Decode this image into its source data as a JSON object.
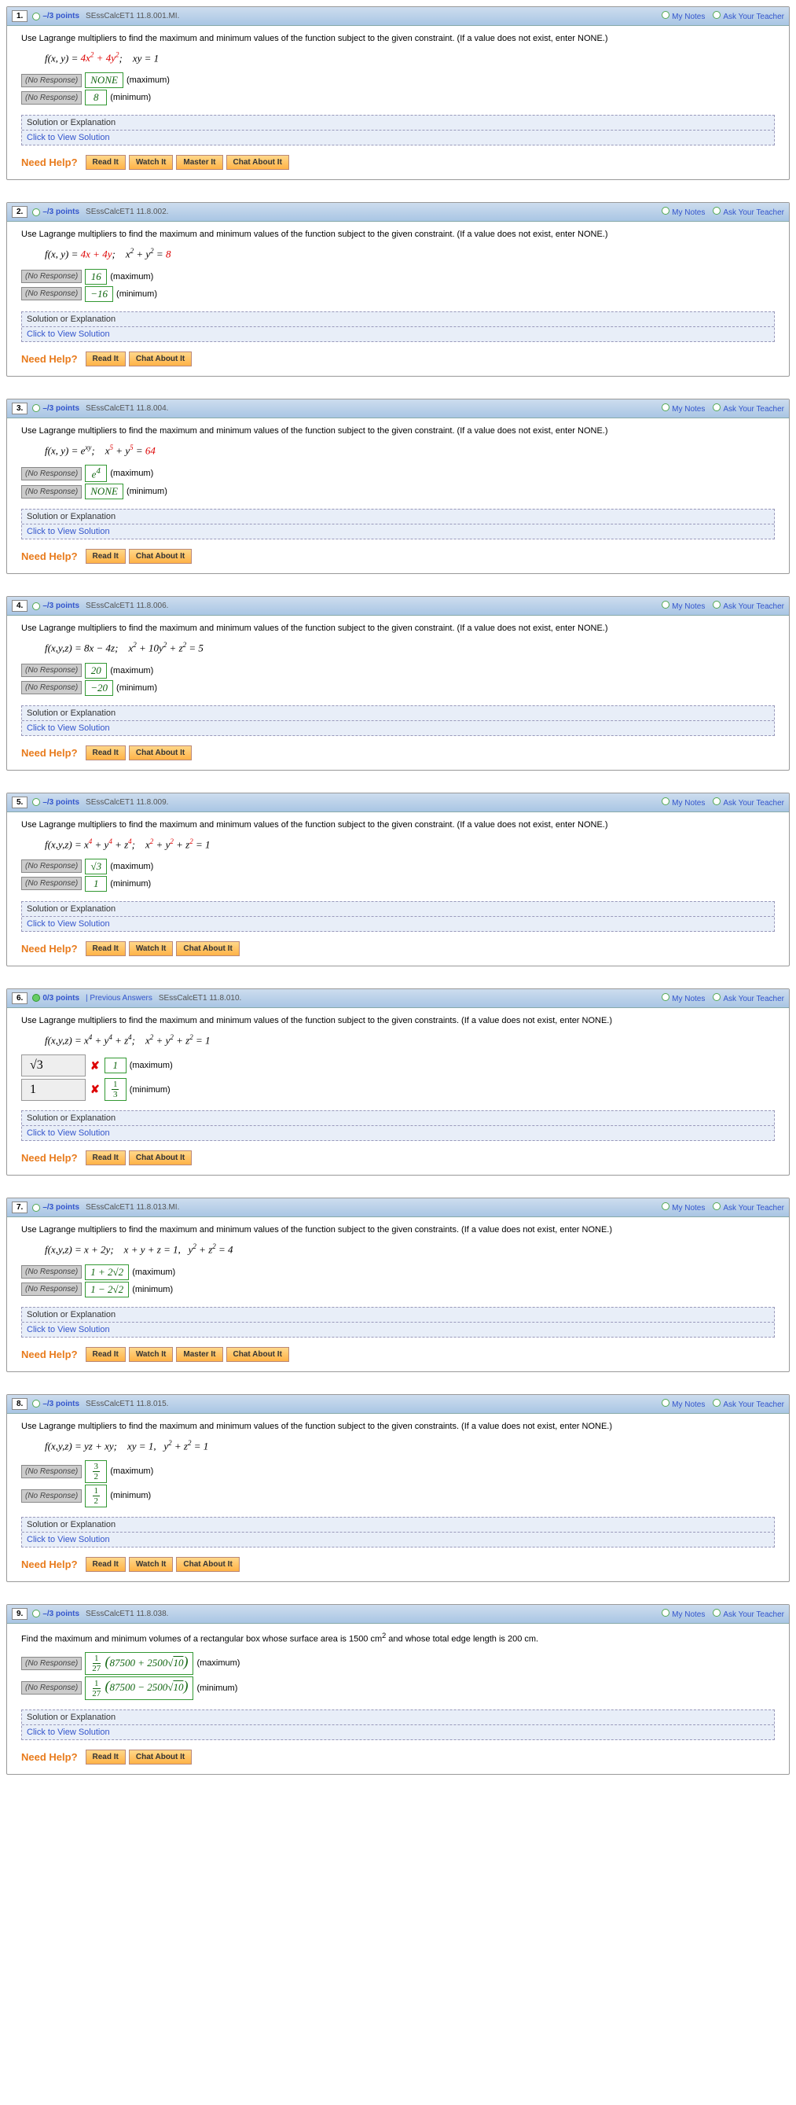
{
  "hdr": {
    "mynotes": "My Notes",
    "ask": "Ask Your Teacher",
    "nores": "(No Response)",
    "max": "(maximum)",
    "min": "(minimum)",
    "sol": "Solution or Explanation",
    "view": "Click to View Solution",
    "help": "Need Help?",
    "prev": "Previous Answers"
  },
  "btn": {
    "read": "Read It",
    "watch": "Watch It",
    "master": "Master It",
    "chat": "Chat About It"
  },
  "q": [
    {
      "num": "1.",
      "pts": "–/3 points",
      "code": "SEssCalcET1 11.8.001.MI.",
      "prompt": "Use Lagrange multipliers to find the maximum and minimum values of the function subject to the given constraint. (If a value does not exist, enter NONE.)",
      "eq_html": "<i>f</i>(<i>x</i>, <i>y</i>) = <span class='red'>4<i>x</i><sup>2</sup> + 4<i>y</i><sup>2</sup></span>; &nbsp;&nbsp; <i>xy</i> = 1",
      "amax": "NONE",
      "amin": "8",
      "buttons": [
        "read",
        "watch",
        "master",
        "chat"
      ]
    },
    {
      "num": "2.",
      "pts": "–/3 points",
      "code": "SEssCalcET1 11.8.002.",
      "prompt": "Use Lagrange multipliers to find the maximum and minimum values of the function subject to the given constraint. (If a value does not exist, enter NONE.)",
      "eq_html": "<i>f</i>(<i>x</i>, <i>y</i>) = <span class='red'>4<i>x</i> + 4<i>y</i></span>; &nbsp;&nbsp; <i>x</i><sup>2</sup> + <i>y</i><sup>2</sup> = <span class='red'>8</span>",
      "amax": "16",
      "amin": "−16",
      "buttons": [
        "read",
        "chat"
      ]
    },
    {
      "num": "3.",
      "pts": "–/3 points",
      "code": "SEssCalcET1 11.8.004.",
      "prompt": "Use Lagrange multipliers to find the maximum and minimum values of the function subject to the given constraint. (If a value does not exist, enter NONE.)",
      "eq_html": "<i>f</i>(<i>x</i>, <i>y</i>) = e<sup><i>xy</i></sup>; &nbsp;&nbsp; <i>x</i><sup><span class='red'>5</span></sup> + <i>y</i><sup><span class='red'>5</span></sup> = <span class='red'>64</span>",
      "amax": "e<sup>4</sup>",
      "amin": "NONE",
      "buttons": [
        "read",
        "chat"
      ]
    },
    {
      "num": "4.",
      "pts": "–/3 points",
      "code": "SEssCalcET1 11.8.006.",
      "prompt": "Use Lagrange multipliers to find the maximum and minimum values of the function subject to the given constraint. (If a value does not exist, enter NONE.)",
      "eq_html": "<i>f</i>(<i>x</i>,<i>y</i>,<i>z</i>) = 8<i>x</i> − 4<i>z</i>; &nbsp;&nbsp; <i>x</i><sup>2</sup> + 10<i>y</i><sup>2</sup> + <i>z</i><sup>2</sup> = 5",
      "amax": "20",
      "amin": "−20",
      "buttons": [
        "read",
        "chat"
      ]
    },
    {
      "num": "5.",
      "pts": "–/3 points",
      "code": "SEssCalcET1 11.8.009.",
      "prompt": "Use Lagrange multipliers to find the maximum and minimum values of the function subject to the given constraint. (If a value does not exist, enter NONE.)",
      "eq_html": "<i>f</i>(<i>x</i>,<i>y</i>,<i>z</i>) = <i>x</i><sup><span class='red'>4</span></sup> + <i>y</i><sup><span class='red'>4</span></sup> + <i>z</i><sup><span class='red'>4</span></sup>; &nbsp;&nbsp; <i>x</i><sup><span class='red'>2</span></sup> + <i>y</i><sup><span class='red'>2</span></sup> + <i>z</i><sup><span class='red'>2</span></sup> = 1",
      "amax": "√3",
      "amin": "1",
      "buttons": [
        "read",
        "watch",
        "chat"
      ]
    },
    {
      "num": "6.",
      "pts": "0/3 points",
      "code": "SEssCalcET1 11.8.010.",
      "prompt": "Use Lagrange multipliers to find the maximum and minimum values of the function subject to the given constraints. (If a value does not exist, enter NONE.)",
      "eq_html": "<i>f</i>(<i>x</i>,<i>y</i>,<i>z</i>) = <i>x</i><sup>4</sup> + <i>y</i><sup>4</sup> + <i>z</i><sup>4</sup>; &nbsp;&nbsp; <i>x</i><sup>2</sup> + <i>y</i><sup>2</sup> + <i>z</i><sup>2</sup> = 1",
      "user_max": "√3",
      "user_min": "1",
      "amax": "1",
      "amin_frac": [
        "1",
        "3"
      ],
      "has_prev": true,
      "wrong": true,
      "buttons": [
        "read",
        "chat"
      ]
    },
    {
      "num": "7.",
      "pts": "–/3 points",
      "code": "SEssCalcET1 11.8.013.MI.",
      "prompt": "Use Lagrange multipliers to find the maximum and minimum values of the function subject to the given constraints. (If a value does not exist, enter NONE.)",
      "eq_html": "<i>f</i>(<i>x</i>,<i>y</i>,<i>z</i>) = <i>x</i> + 2<i>y</i>; &nbsp;&nbsp; <i>x</i> + <i>y</i> + <i>z</i> = 1, &nbsp; <i>y</i><sup>2</sup> + <i>z</i><sup>2</sup> = 4",
      "amax": "1 + 2√2",
      "amin": "1 − 2√2",
      "buttons": [
        "read",
        "watch",
        "master",
        "chat"
      ]
    },
    {
      "num": "8.",
      "pts": "–/3 points",
      "code": "SEssCalcET1 11.8.015.",
      "prompt": "Use Lagrange multipliers to find the maximum and minimum values of the function subject to the given constraints. (If a value does not exist, enter NONE.)",
      "eq_html": "<i>f</i>(<i>x</i>,<i>y</i>,<i>z</i>) = <i>yz</i> + <i>xy</i>; &nbsp;&nbsp; <i>xy</i> = 1, &nbsp; <i>y</i><sup>2</sup> + <i>z</i><sup>2</sup> = 1",
      "amax_frac": [
        "3",
        "2"
      ],
      "amin_frac": [
        "1",
        "2"
      ],
      "buttons": [
        "read",
        "watch",
        "chat"
      ]
    },
    {
      "num": "9.",
      "pts": "–/3 points",
      "code": "SEssCalcET1 11.8.038.",
      "prompt": "Find the maximum and minimum volumes of a rectangular box whose surface area is 1500 cm<sup>2</sup> and whose total edge length is 200 cm.",
      "eq_html": "",
      "amax_big": {
        "pre": "1",
        "den": "27",
        "inner": "87500 + 2500√10"
      },
      "amin_big": {
        "pre": "1",
        "den": "27",
        "inner": "87500 − 2500√10"
      },
      "buttons": [
        "read",
        "chat"
      ]
    }
  ]
}
